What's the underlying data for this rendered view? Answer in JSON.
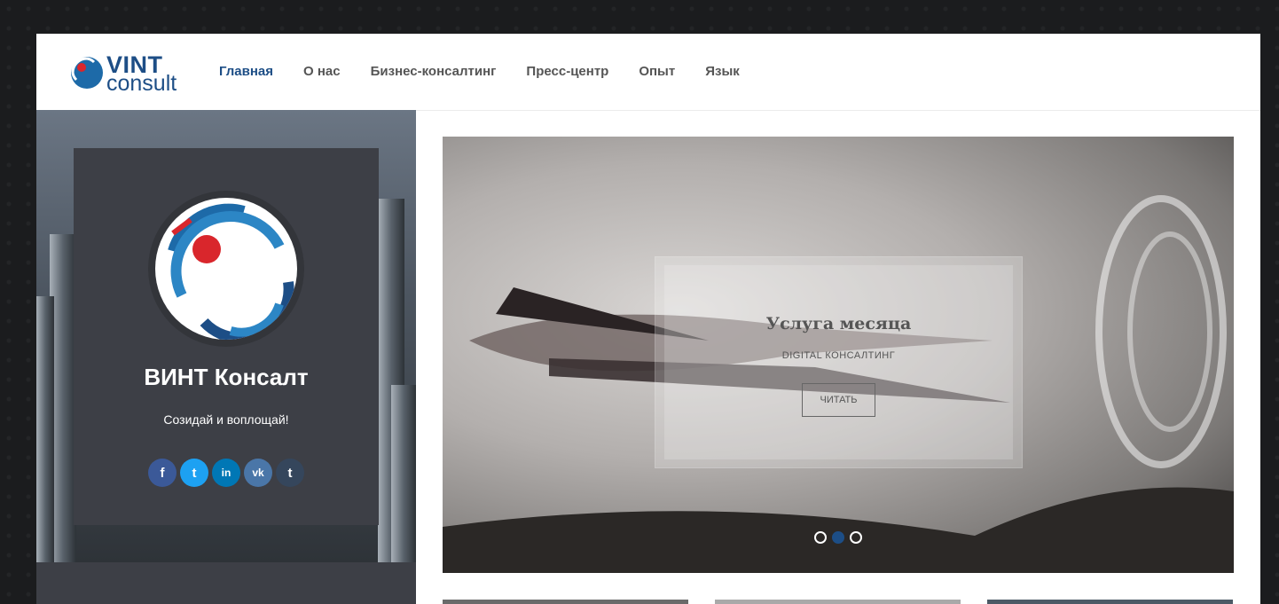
{
  "logo": {
    "line1": "VINT",
    "line2": "consult"
  },
  "nav": [
    {
      "label": "Главная",
      "active": true
    },
    {
      "label": "О нас"
    },
    {
      "label": "Бизнес-консалтинг"
    },
    {
      "label": "Пресс-центр"
    },
    {
      "label": "Опыт"
    },
    {
      "label": "Язык"
    }
  ],
  "profile": {
    "name": "ВИНТ Консалт",
    "tagline": "Созидай и воплощай!"
  },
  "socials": [
    {
      "glyph": "f",
      "icon": "facebook-icon",
      "color": "#3b5998"
    },
    {
      "glyph": "t",
      "icon": "twitter-icon",
      "color": "#1da1f2"
    },
    {
      "glyph": "in",
      "icon": "linkedin-icon",
      "color": "#0077b5"
    },
    {
      "glyph": "vk",
      "icon": "vk-icon",
      "color": "#4a76a8"
    },
    {
      "glyph": "t",
      "icon": "tumblr-icon",
      "color": "#35465c"
    }
  ],
  "slide": {
    "title": "Услуга месяца",
    "subtitle": "DIGITAL КОНСАЛТИНГ",
    "button": "ЧИТАТЬ",
    "active_index": 1,
    "count": 3
  },
  "colors": {
    "accent": "#1d4e86",
    "sidebar": "#3d3f46"
  }
}
